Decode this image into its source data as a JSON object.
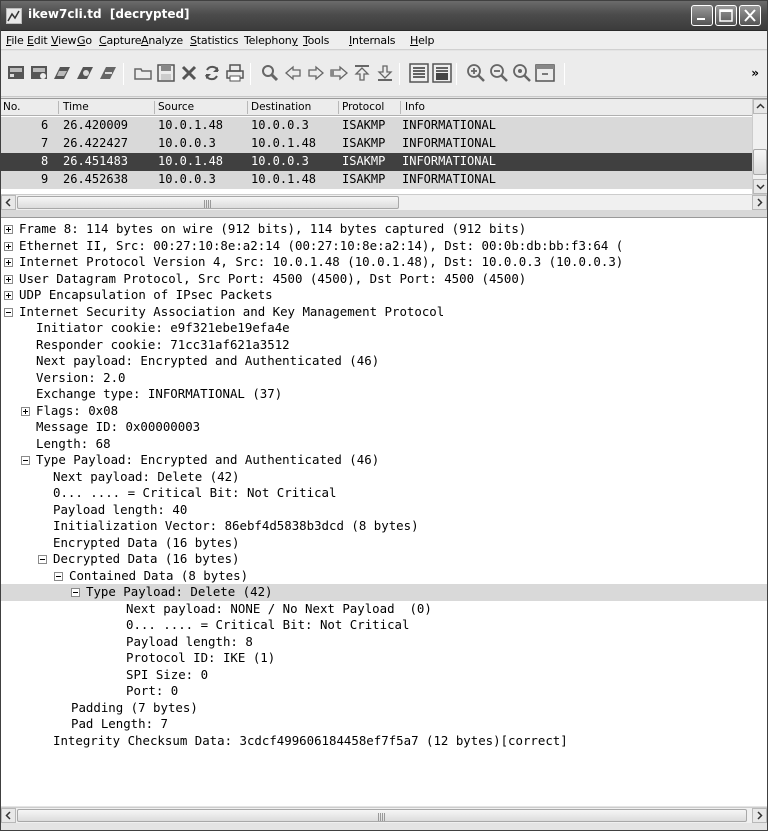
{
  "window": {
    "title": "ikew7cli.td  [decrypted]",
    "controls": {
      "minimize": "minimize",
      "maximize": "maximize",
      "close": "close"
    }
  },
  "menu": [
    {
      "label": "File",
      "underline": "F"
    },
    {
      "label": "Edit",
      "underline": "E"
    },
    {
      "label": "View",
      "underline": "V"
    },
    {
      "label": "Go",
      "underline": "G"
    },
    {
      "label": "Capture",
      "underline": "C"
    },
    {
      "label": "Analyze",
      "underline": "A"
    },
    {
      "label": "Statistics",
      "underline": "S"
    },
    {
      "label": "Telephony",
      "underline": "y"
    },
    {
      "label": "Tools",
      "underline": "T"
    },
    {
      "label": "Internals",
      "underline": "I"
    },
    {
      "label": "Help",
      "underline": "H"
    }
  ],
  "toolbar": {
    "icons": [
      "interface-list-icon",
      "capture-options-icon",
      "start-capture-icon",
      "stop-capture-icon",
      "restart-capture-icon",
      "open-file-icon",
      "save-file-icon",
      "close-file-icon",
      "reload-icon",
      "print-icon",
      "find-packet-icon",
      "go-back-icon",
      "go-forward-icon",
      "go-to-packet-icon",
      "go-first-icon",
      "go-last-icon",
      "colorize-icon",
      "auto-scroll-icon",
      "zoom-in-icon",
      "zoom-out-icon",
      "normal-size-icon",
      "resize-columns-icon"
    ],
    "more": "»"
  },
  "packet_list": {
    "columns": [
      "No.",
      "Time",
      "Source",
      "Destination",
      "Protocol",
      "Info"
    ],
    "rows": [
      {
        "no": "6",
        "time": "26.420009",
        "source": "10.0.1.48",
        "destination": "10.0.0.3",
        "protocol": "ISAKMP",
        "info": "INFORMATIONAL",
        "state": "light"
      },
      {
        "no": "7",
        "time": "26.422427",
        "source": "10.0.0.3",
        "destination": "10.0.1.48",
        "protocol": "ISAKMP",
        "info": "INFORMATIONAL",
        "state": "light"
      },
      {
        "no": "8",
        "time": "26.451483",
        "source": "10.0.1.48",
        "destination": "10.0.0.3",
        "protocol": "ISAKMP",
        "info": "INFORMATIONAL",
        "state": "selected"
      },
      {
        "no": "9",
        "time": "26.452638",
        "source": "10.0.0.3",
        "destination": "10.0.1.48",
        "protocol": "ISAKMP",
        "info": "INFORMATIONAL",
        "state": "light"
      }
    ]
  },
  "details": {
    "lines": [
      {
        "text": "Frame 8: 114 bytes on wire (912 bits), 114 bytes captured (912 bits)",
        "level": 0,
        "toggle": "plus"
      },
      {
        "text": "Ethernet II, Src: 00:27:10:8e:a2:14 (00:27:10:8e:a2:14), Dst: 00:0b:db:bb:f3:64 (",
        "level": 0,
        "toggle": "plus"
      },
      {
        "text": "Internet Protocol Version 4, Src: 10.0.1.48 (10.0.1.48), Dst: 10.0.0.3 (10.0.0.3)",
        "level": 0,
        "toggle": "plus"
      },
      {
        "text": "User Datagram Protocol, Src Port: 4500 (4500), Dst Port: 4500 (4500)",
        "level": 0,
        "toggle": "plus"
      },
      {
        "text": "UDP Encapsulation of IPsec Packets",
        "level": 0,
        "toggle": "plus"
      },
      {
        "text": "Internet Security Association and Key Management Protocol",
        "level": 0,
        "toggle": "minus"
      },
      {
        "text": "Initiator cookie: e9f321ebe19efa4e",
        "level": 1,
        "toggle": "none"
      },
      {
        "text": "Responder cookie: 71cc31af621a3512",
        "level": 1,
        "toggle": "none"
      },
      {
        "text": "Next payload: Encrypted and Authenticated (46)",
        "level": 1,
        "toggle": "none"
      },
      {
        "text": "Version: 2.0",
        "level": 1,
        "toggle": "none"
      },
      {
        "text": "Exchange type: INFORMATIONAL (37)",
        "level": 1,
        "toggle": "none"
      },
      {
        "text": "Flags: 0x08",
        "level": 1,
        "toggle": "plus"
      },
      {
        "text": "Message ID: 0x00000003",
        "level": 1,
        "toggle": "none"
      },
      {
        "text": "Length: 68",
        "level": 1,
        "toggle": "none"
      },
      {
        "text": "Type Payload: Encrypted and Authenticated (46)",
        "level": 1,
        "toggle": "minus"
      },
      {
        "text": "Next payload: Delete (42)",
        "level": 2,
        "toggle": "none"
      },
      {
        "text": "0... .... = Critical Bit: Not Critical",
        "level": 2,
        "toggle": "none"
      },
      {
        "text": "Payload length: 40",
        "level": 2,
        "toggle": "none"
      },
      {
        "text": "Initialization Vector: 86ebf4d5838b3dcd (8 bytes)",
        "level": 2,
        "toggle": "none"
      },
      {
        "text": "Encrypted Data (16 bytes)",
        "level": 2,
        "toggle": "none"
      },
      {
        "text": "Decrypted Data (16 bytes)",
        "level": 2,
        "toggle": "minus"
      },
      {
        "text": "Contained Data (8 bytes)",
        "level": 3,
        "toggle": "minus"
      },
      {
        "text": "Type Payload: Delete (42)",
        "level": 4,
        "toggle": "minus",
        "highlight": true
      },
      {
        "text": "Next payload: NONE / No Next Payload  (0)",
        "level": 5,
        "toggle": "none"
      },
      {
        "text": "0... .... = Critical Bit: Not Critical",
        "level": 5,
        "toggle": "none"
      },
      {
        "text": "Payload length: 8",
        "level": 5,
        "toggle": "none"
      },
      {
        "text": "Protocol ID: IKE (1)",
        "level": 5,
        "toggle": "none"
      },
      {
        "text": "SPI Size: 0",
        "level": 5,
        "toggle": "none"
      },
      {
        "text": "Port: 0",
        "level": 5,
        "toggle": "none"
      },
      {
        "text": "Padding (7 bytes)",
        "level": 3,
        "toggle": "none"
      },
      {
        "text": "Pad Length: 7",
        "level": 3,
        "toggle": "none"
      },
      {
        "text": "Integrity Checksum Data: 3cdcf499606184458ef7f5a7 (12 bytes)[correct]",
        "level": 2,
        "toggle": "none"
      }
    ]
  },
  "colors": {
    "selected_row": "#404040",
    "highlight_row": "#d9d9d9",
    "titlebar": "#4c4c4c"
  }
}
